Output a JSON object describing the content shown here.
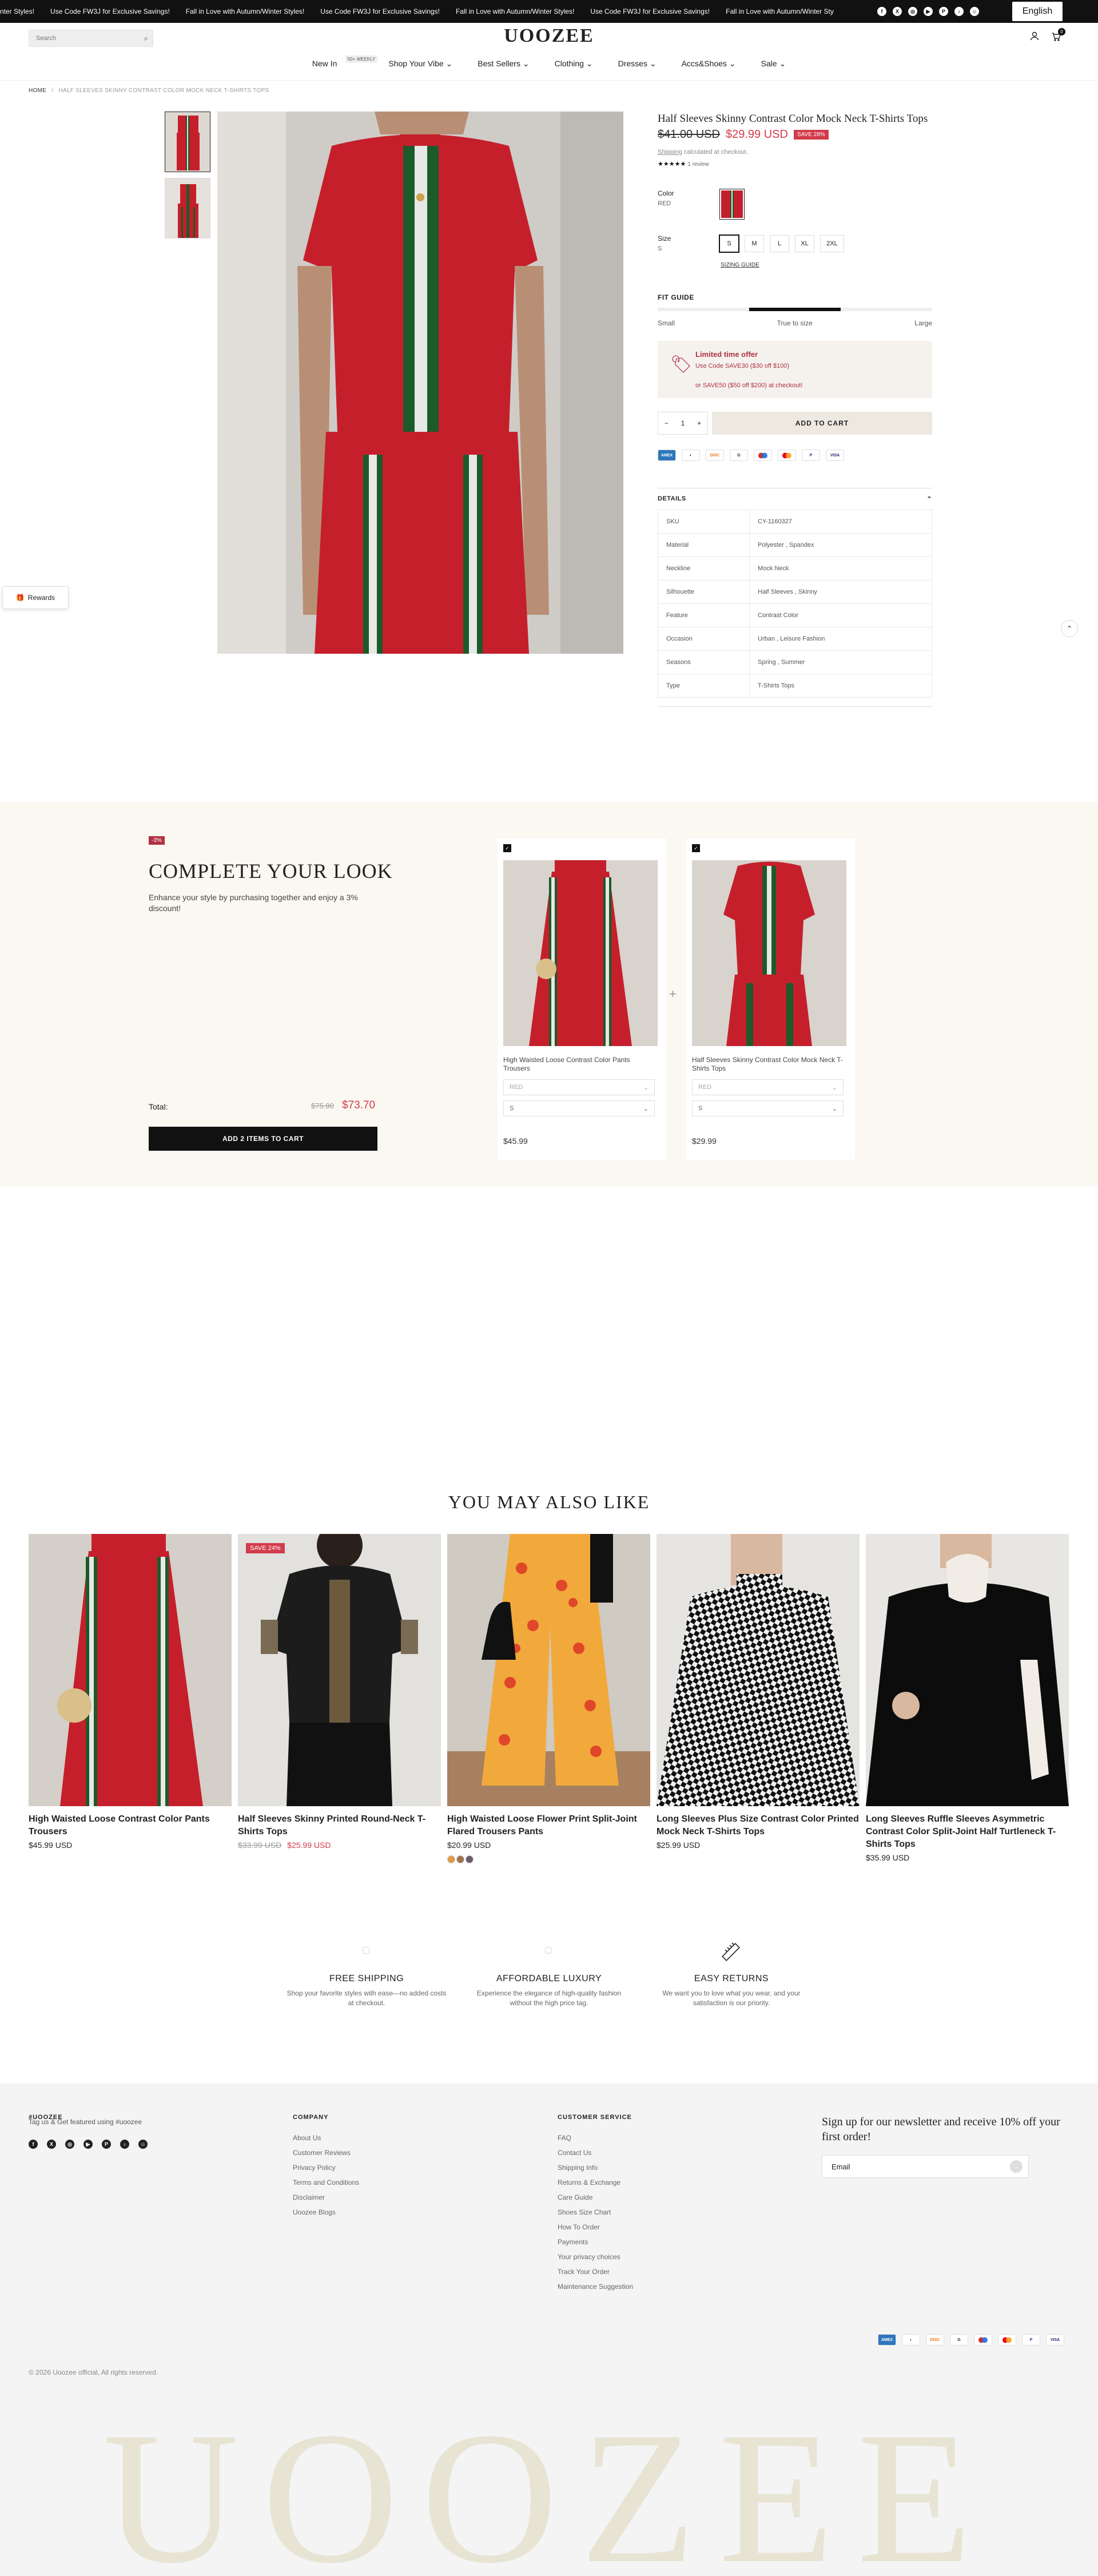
{
  "announcement": {
    "messages": [
      "nter Styles!",
      "Use Code FW3J for Exclusive Savings!",
      "Fall in Love with Autumn/Winter Styles!",
      "Use Code FW3J for Exclusive Savings!",
      "Fall in Love with Autumn/Winter Styles!",
      "Use Code FW3J for Exclusive Savings!",
      "Fall in Love with Autumn/Winter Sty"
    ],
    "social_icons": [
      "facebook-icon",
      "x-icon",
      "instagram-icon",
      "youtube-icon",
      "pinterest-icon",
      "tiktok-icon",
      "snapchat-icon"
    ],
    "language": "English"
  },
  "header": {
    "search_placeholder": "Search",
    "logo": "UOOZEE",
    "cart_count": "0",
    "nav": [
      {
        "label": "New In",
        "badge": "50+ WEEKLY"
      },
      {
        "label": "Shop Your Vibe ⌄"
      },
      {
        "label": "Best Sellers ⌄"
      },
      {
        "label": "Clothing ⌄"
      },
      {
        "label": "Dresses ⌄"
      },
      {
        "label": "Accs&Shoes ⌄"
      },
      {
        "label": "Sale ⌄"
      }
    ]
  },
  "breadcrumb": {
    "home": "HOME",
    "sep": "/",
    "current": "HALF SLEEVES SKINNY CONTRAST COLOR MOCK NECK T-SHIRTS TOPS"
  },
  "product": {
    "title": "Half Sleeves Skinny Contrast Color Mock Neck T-Shirts Tops",
    "old_price": "$41.00 USD",
    "price": "$29.99 USD",
    "save": "SAVE 28%",
    "shipping_link": "Shipping",
    "shipping_text": " calculated at checkout.",
    "stars": "★★★★★",
    "reviews": "1 review",
    "color_label": "Color",
    "color_value": "RED",
    "size_label": "Size",
    "size_value": "S",
    "sizes": [
      "S",
      "M",
      "L",
      "XL",
      "2XL"
    ],
    "sizing_guide": "SIZING GUIDE",
    "fit_guide": "FIT GUIDE",
    "fit_labels": [
      "Small",
      "True to size",
      "Large"
    ],
    "offer_title": "Limited time offer",
    "offer_line1": "Use Code SAVE30 ($30 off $100)",
    "offer_line2": "or SAVE50 ($50 off $200) at checkout!",
    "qty": "1",
    "qty_minus": "−",
    "qty_plus": "+",
    "add_to_cart": "ADD TO CART",
    "payments": [
      "AMEX",
      "Pay",
      "DISC",
      "GPay",
      "Maestro",
      "MC",
      "PayPal",
      "VISA"
    ],
    "details_label": "DETAILS",
    "specs": [
      [
        "SKU",
        "CY-1160327"
      ],
      [
        "Material",
        "Polyester , Spandex"
      ],
      [
        "Neckline",
        "Mock Neck"
      ],
      [
        "Silhouette",
        "Half Sleeves , Skinny"
      ],
      [
        "Feature",
        "Contrast Color"
      ],
      [
        "Occasion",
        "Urban , Leisure Fashion"
      ],
      [
        "Seasons",
        "Spring , Summer"
      ],
      [
        "Type",
        "T-Shirts Tops"
      ]
    ]
  },
  "rewards": "Rewards",
  "complete_look": {
    "discount": "-3%",
    "title": "COMPLETE YOUR LOOK",
    "subtitle": "Enhance your style by purchasing together and enjoy a 3% discount!",
    "total_label": "Total:",
    "total_old": "$75.90",
    "total_new": "$73.70",
    "button": "ADD 2 ITEMS TO CART",
    "items": [
      {
        "name": "High Waisted Loose Contrast Color Pants Trousers",
        "color": "RED",
        "size": "S",
        "price": "$45.99"
      },
      {
        "name": "Half Sleeves Skinny Contrast Color Mock Neck T-Shirts Tops",
        "color": "RED",
        "size": "S",
        "price": "$29.99"
      }
    ]
  },
  "also_like": {
    "title": "YOU MAY ALSO LIKE",
    "products": [
      {
        "name": "High Waisted Loose Contrast Color Pants Trousers",
        "price": "$45.99 USD"
      },
      {
        "name": "Half Sleeves Skinny Printed Round-Neck T-Shirts Tops",
        "old_price": "$33.99 USD",
        "price": "$25.99 USD",
        "badge": "SAVE 24%"
      },
      {
        "name": "High Waisted Loose Flower Print Split-Joint Flared Trousers Pants",
        "price": "$20.99 USD"
      },
      {
        "name": "Long Sleeves Plus Size Contrast Color Printed Mock Neck T-Shirts Tops",
        "price": "$25.99 USD"
      },
      {
        "name": "Long Sleeves Ruffle Sleeves Asymmetric Contrast Color Split-Joint Half Turtleneck T-Shirts Tops",
        "price": "$35.99 USD"
      }
    ]
  },
  "features": [
    {
      "title": "FREE SHIPPING",
      "desc": "Shop your favorite styles with ease—no added costs at checkout."
    },
    {
      "title": "AFFORDABLE LUXURY",
      "desc": "Experience the elegance of high-quality fashion without the high price tag."
    },
    {
      "title": "EASY RETURNS",
      "desc": "We want you to love what you wear, and your satisfaction is our priority."
    }
  ],
  "footer": {
    "brand_head": "#UOOZEE",
    "brand_text": "Tag us & Get featured using #uoozee",
    "company_head": "COMPANY",
    "company_links": [
      "About Us",
      "Customer Reviews",
      "Privacy Policy",
      "Terms and Conditions",
      "Disclaimer",
      "Uoozee Blogs"
    ],
    "service_head": "CUSTOMER SERVICE",
    "service_links": [
      "FAQ",
      "Contact Us",
      "Shipping Info",
      "Returns & Exchange",
      "Care Guide",
      "Shoes Size Chart",
      "How To Order",
      "Payments",
      "Your privacy choices",
      "Track Your Order",
      "Maintenance Suggestion"
    ],
    "newsletter": "Sign up for our newsletter and receive 10% off your first order!",
    "email_placeholder": "Email",
    "copyright": "© 2026 Uoozee official, All rights reserved.",
    "big_word": "UOOZEE"
  },
  "colors": {
    "accent": "#d23b4a",
    "dark": "#111111",
    "cream": "#fbf8f1",
    "product_red": "#c61f2c",
    "stripe_green": "#1d5a2a"
  }
}
